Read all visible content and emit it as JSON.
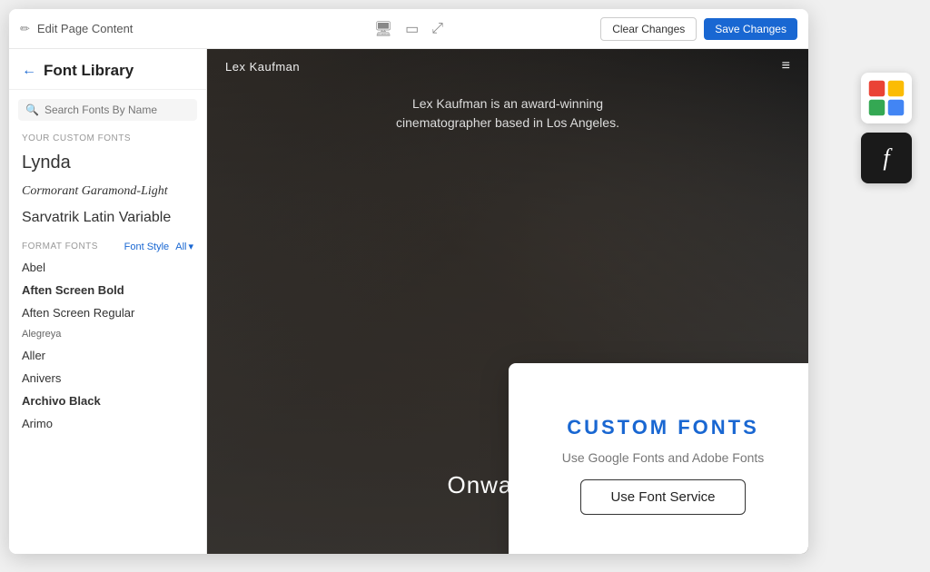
{
  "sidebar": {
    "title": "Font Library",
    "search_placeholder": "Search Fonts By Name",
    "custom_fonts_label": "YOUR CUSTOM FONTS",
    "custom_fonts": [
      {
        "name": "Lynda",
        "style": "lynda"
      },
      {
        "name": "Cormorant Garamond-Light",
        "style": "cormorant"
      },
      {
        "name": "Sarvatrik Latin Variable",
        "style": "sarvatrik"
      }
    ],
    "format_fonts_label": "FORMAT FONTS",
    "font_style_label": "Font Style",
    "font_style_value": "All",
    "font_list": [
      {
        "name": "Abel",
        "style": "normal"
      },
      {
        "name": "Aften Screen Bold",
        "style": "bold"
      },
      {
        "name": "Aften Screen Regular",
        "style": "normal"
      },
      {
        "name": "Alegreya",
        "style": "small"
      },
      {
        "name": "Aller",
        "style": "normal"
      },
      {
        "name": "Anivers",
        "style": "normal"
      },
      {
        "name": "Archivo Black",
        "style": "bold"
      },
      {
        "name": "Arimo",
        "style": "normal"
      }
    ]
  },
  "topbar": {
    "edit_label": "Edit Page Content",
    "clear_label": "Clear Changes",
    "save_label": "Save Changes"
  },
  "preview": {
    "site_name": "Lex Kaufman",
    "tagline": "Lex Kaufman is an award-winning cinematographer based in Los Angeles.",
    "cta_text": "Onward"
  },
  "popup": {
    "title": "CUSTOM  FONTS",
    "subtitle": "Use Google Fonts and Adobe Fonts",
    "button_label": "Use Font Service"
  },
  "icons": {
    "back": "←",
    "search": "🔍",
    "edit": "✏",
    "desktop": "🖥",
    "tablet": "⬜",
    "expand": "⤢",
    "hamburger": "≡",
    "chevron_down": "▾",
    "arrow_right": "›",
    "font_f": "f"
  }
}
